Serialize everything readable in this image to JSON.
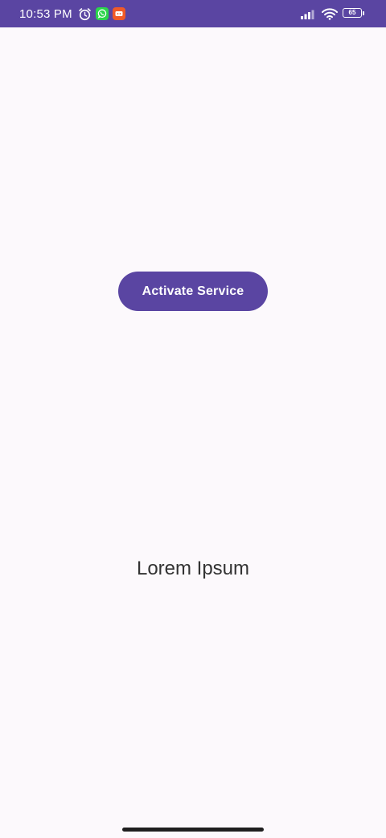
{
  "status_bar": {
    "time": "10:53 PM",
    "battery_level": "65",
    "background_color": "#5a45a2",
    "icons": [
      "alarm-icon",
      "whatsapp-icon",
      "notification-app-icon",
      "signal-icon",
      "wifi-icon",
      "battery-icon"
    ]
  },
  "main": {
    "button_label": "Activate Service",
    "body_text": "Lorem Ipsum"
  },
  "colors": {
    "accent": "#5a45a2",
    "background": "#fcf9fc",
    "text": "#333333"
  }
}
